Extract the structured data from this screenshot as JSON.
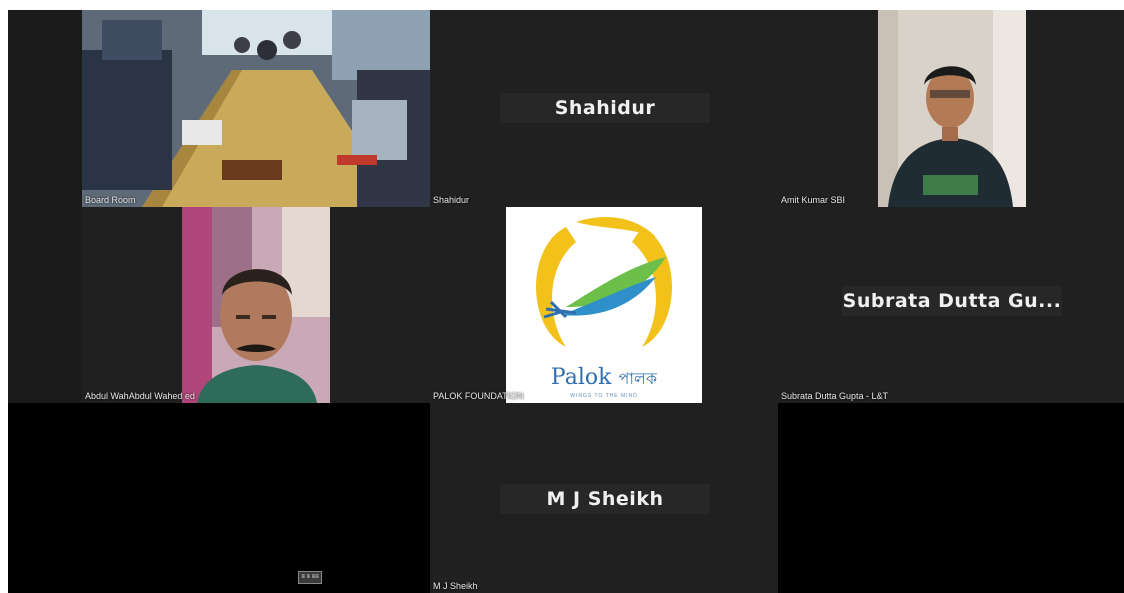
{
  "meeting": {
    "participants": [
      {
        "id": "board_room",
        "label": "Board Room",
        "video": true
      },
      {
        "id": "shahidur",
        "label": "Shahidur",
        "display_name": "Shahidur",
        "video": false
      },
      {
        "id": "amit",
        "label": "Amit Kumar SBI",
        "video": true
      },
      {
        "id": "abdul",
        "label": "Abdul WahAbdul Wahed ed",
        "video": true
      },
      {
        "id": "palok",
        "label": "PALOK FOUNDATION",
        "video": true,
        "logo_text": "Palok",
        "logo_text_bn": "পালক",
        "logo_tagline": "WINGS TO THE MIND"
      },
      {
        "id": "subrata",
        "label": "Subrata Dutta Gupta - L&T",
        "display_name": "Subrata  Dutta  Gu...",
        "video": false
      },
      {
        "id": "empty_left",
        "label": "",
        "video": false,
        "badge": "≡ ≡ ≡≡"
      },
      {
        "id": "mj_sheikh",
        "label": "M J Sheikh",
        "display_name": "M J Sheikh",
        "video": false
      }
    ]
  },
  "colors": {
    "background": "#1b1b1b",
    "tile": "#202020",
    "name_plate": "#272727",
    "logo_blue": "#2f6fb0",
    "logo_yellow": "#f2c21b",
    "logo_green": "#6cc04a"
  }
}
